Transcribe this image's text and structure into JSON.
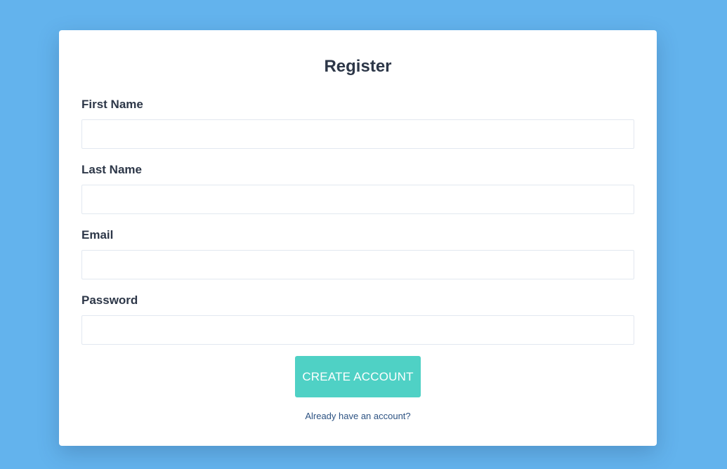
{
  "form": {
    "title": "Register",
    "fields": [
      {
        "label": "First Name",
        "value": "",
        "placeholder": ""
      },
      {
        "label": "Last Name",
        "value": "",
        "placeholder": ""
      },
      {
        "label": "Email",
        "value": "",
        "placeholder": ""
      },
      {
        "label": "Password",
        "value": "",
        "placeholder": ""
      }
    ],
    "submit_label": "CREATE ACCOUNT",
    "login_link": "Already have an account?"
  },
  "colors": {
    "background": "#63b3ed",
    "card": "#ffffff",
    "accent": "#4fd1c5",
    "text": "#2d3748",
    "link": "#2c5282"
  }
}
